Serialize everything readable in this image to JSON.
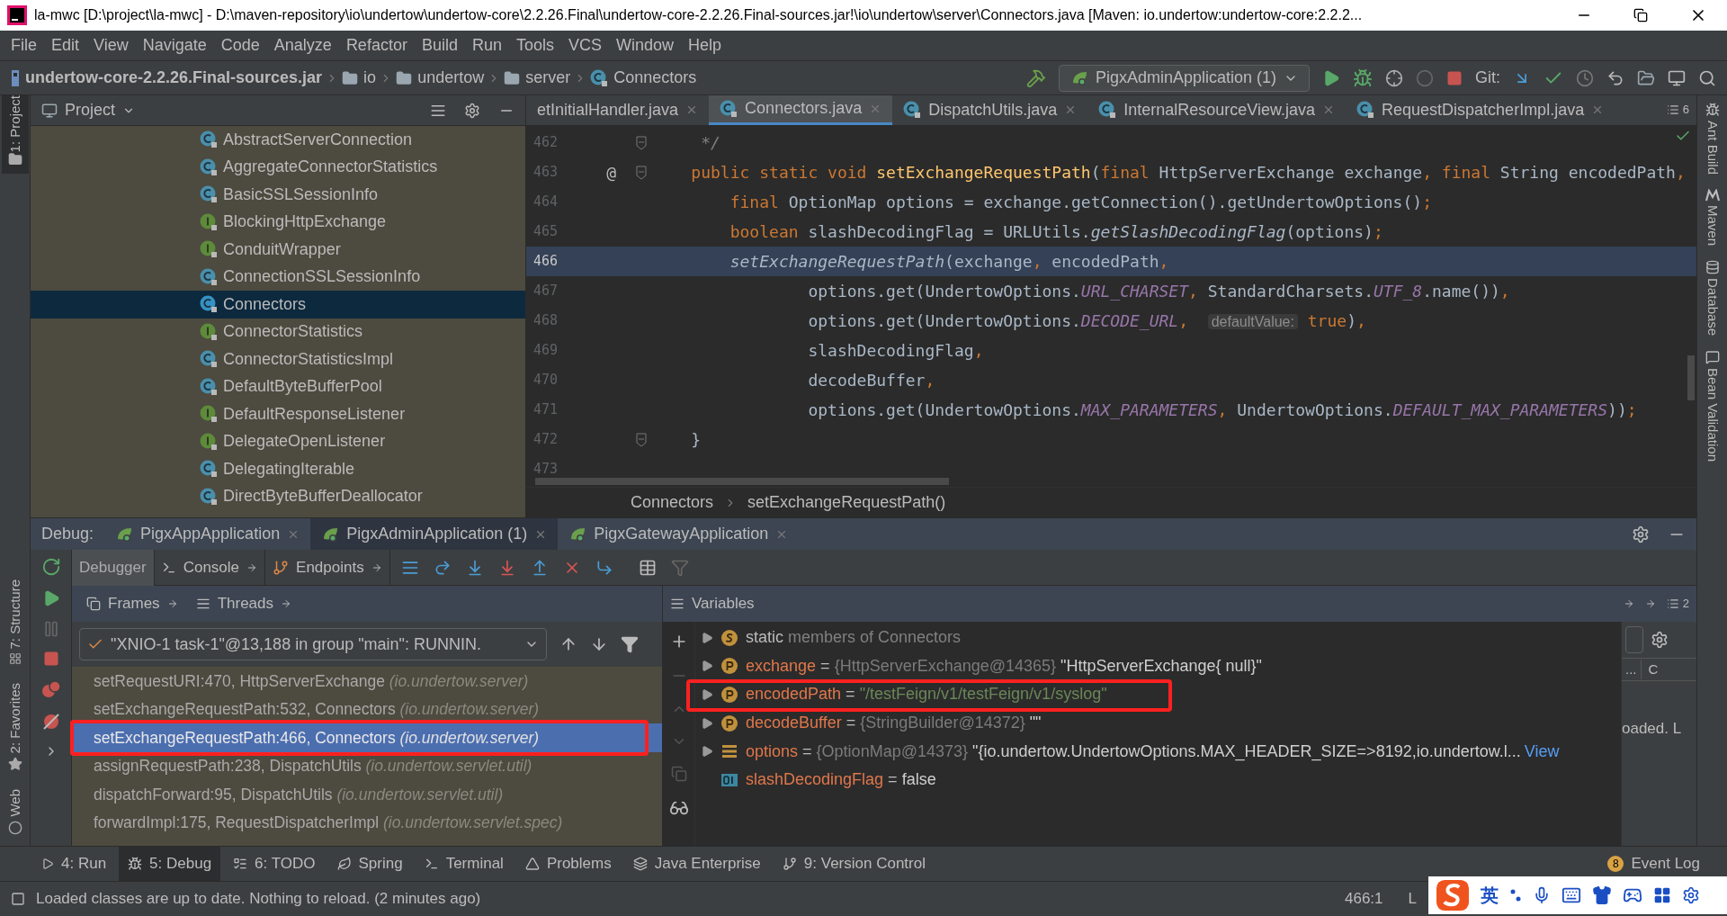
{
  "window": {
    "title": "la-mwc [D:\\project\\la-mwc] - D:\\maven-repository\\io\\undertow\\undertow-core\\2.2.26.Final\\undertow-core-2.2.26.Final-sources.jar!\\io\\undertow\\server\\Connectors.java [Maven: io.undertow:undertow-core:2.2.2..."
  },
  "menu": [
    "File",
    "Edit",
    "View",
    "Navigate",
    "Code",
    "Analyze",
    "Refactor",
    "Build",
    "Run",
    "Tools",
    "VCS",
    "Window",
    "Help"
  ],
  "nav": {
    "crumbs": [
      {
        "label": "undertow-core-2.2.26.Final-sources.jar",
        "kind": "jar"
      },
      {
        "label": "io",
        "kind": "folder"
      },
      {
        "label": "undertow",
        "kind": "folder"
      },
      {
        "label": "server",
        "kind": "folder"
      },
      {
        "label": "Connectors",
        "kind": "class"
      }
    ],
    "run_config": "PigxAdminApplication (1)",
    "git_label": "Git:"
  },
  "left_strip": [
    {
      "label": "1: Project",
      "selected": true
    },
    {
      "label": "7: Structure",
      "selected": false
    },
    {
      "label": "2: Favorites",
      "selected": false
    },
    {
      "label": "Web",
      "selected": false
    }
  ],
  "right_strip": [
    "Ant Build",
    "Maven",
    "Database",
    "Bean Validation"
  ],
  "project": {
    "title": "Project",
    "items": [
      {
        "label": "AbstractServerConnection",
        "kind": "class",
        "selected": false
      },
      {
        "label": "AggregateConnectorStatistics",
        "kind": "class",
        "selected": false
      },
      {
        "label": "BasicSSLSessionInfo",
        "kind": "class",
        "selected": false
      },
      {
        "label": "BlockingHttpExchange",
        "kind": "interface",
        "selected": false
      },
      {
        "label": "ConduitWrapper",
        "kind": "interface",
        "selected": false
      },
      {
        "label": "ConnectionSSLSessionInfo",
        "kind": "class",
        "selected": false
      },
      {
        "label": "Connectors",
        "kind": "class",
        "selected": true
      },
      {
        "label": "ConnectorStatistics",
        "kind": "interface",
        "selected": false
      },
      {
        "label": "ConnectorStatisticsImpl",
        "kind": "class",
        "selected": false
      },
      {
        "label": "DefaultByteBufferPool",
        "kind": "class",
        "selected": false
      },
      {
        "label": "DefaultResponseListener",
        "kind": "interface",
        "selected": false
      },
      {
        "label": "DelegateOpenListener",
        "kind": "interface",
        "selected": false
      },
      {
        "label": "DelegatingIterable",
        "kind": "class",
        "selected": false
      },
      {
        "label": "DirectByteBufferDeallocator",
        "kind": "class",
        "selected": false
      }
    ]
  },
  "editor": {
    "tabs": [
      {
        "label": "etInitialHandler.java",
        "selected": false
      },
      {
        "label": "Connectors.java",
        "selected": true
      },
      {
        "label": "DispatchUtils.java",
        "selected": false
      },
      {
        "label": "InternalResourceView.java",
        "selected": false
      },
      {
        "label": "RequestDispatcherImpl.java",
        "selected": false
      }
    ],
    "tab_count": "6",
    "lines": [
      {
        "number": "462",
        "current": false,
        "tokens": [
          {
            "kind": "comment",
            "text": "     */"
          }
        ]
      },
      {
        "number": "463",
        "current": false,
        "override": "@",
        "tokens": [
          {
            "kind": "keyword",
            "text": "    public static void "
          },
          {
            "kind": "method",
            "text": "setExchangeRequestPath"
          },
          {
            "kind": "plain",
            "text": "("
          },
          {
            "kind": "keyword",
            "text": "final "
          },
          {
            "kind": "plain",
            "text": "HttpServerExchange exchange"
          },
          {
            "kind": "keyword",
            "text": ", final "
          },
          {
            "kind": "plain",
            "text": "String encodedPath"
          },
          {
            "kind": "keyword",
            "text": ","
          }
        ]
      },
      {
        "number": "464",
        "current": false,
        "tokens": [
          {
            "kind": "keyword",
            "text": "        final "
          },
          {
            "kind": "plain",
            "text": "OptionMap options = exchange.getConnection().getUndertowOptions()"
          },
          {
            "kind": "keyword",
            "text": ";"
          }
        ]
      },
      {
        "number": "465",
        "current": false,
        "tokens": [
          {
            "kind": "keyword",
            "text": "        boolean "
          },
          {
            "kind": "plain",
            "text": "slashDecodingFlag = URLUtils."
          },
          {
            "kind": "static_call",
            "text": "getSlashDecodingFlag"
          },
          {
            "kind": "plain",
            "text": "(options)"
          },
          {
            "kind": "keyword",
            "text": ";"
          }
        ]
      },
      {
        "number": "466",
        "current": true,
        "tokens": [
          {
            "kind": "static_call",
            "text": "        setExchangeRequestPath"
          },
          {
            "kind": "plain",
            "text": "(exchange"
          },
          {
            "kind": "keyword",
            "text": ", "
          },
          {
            "kind": "plain",
            "text": "encodedPath"
          },
          {
            "kind": "keyword",
            "text": ","
          }
        ]
      },
      {
        "number": "467",
        "current": false,
        "tokens": [
          {
            "kind": "plain",
            "text": "                options.get(UndertowOptions."
          },
          {
            "kind": "field",
            "text": "URL_CHARSET"
          },
          {
            "kind": "keyword",
            "text": ", "
          },
          {
            "kind": "plain",
            "text": "StandardCharsets."
          },
          {
            "kind": "field",
            "text": "UTF_8"
          },
          {
            "kind": "plain",
            "text": ".name())"
          },
          {
            "kind": "keyword",
            "text": ","
          }
        ]
      },
      {
        "number": "468",
        "current": false,
        "tokens": [
          {
            "kind": "plain",
            "text": "                options.get(UndertowOptions."
          },
          {
            "kind": "field",
            "text": "DECODE_URL"
          },
          {
            "kind": "keyword",
            "text": ",  "
          },
          {
            "kind": "hint",
            "text": "defaultValue:"
          },
          {
            "kind": "keyword",
            "text": " true"
          },
          {
            "kind": "plain",
            "text": ")"
          },
          {
            "kind": "keyword",
            "text": ","
          }
        ]
      },
      {
        "number": "469",
        "current": false,
        "tokens": [
          {
            "kind": "plain",
            "text": "                slashDecodingFlag"
          },
          {
            "kind": "keyword",
            "text": ","
          }
        ]
      },
      {
        "number": "470",
        "current": false,
        "tokens": [
          {
            "kind": "plain",
            "text": "                decodeBuffer"
          },
          {
            "kind": "keyword",
            "text": ","
          }
        ]
      },
      {
        "number": "471",
        "current": false,
        "tokens": [
          {
            "kind": "plain",
            "text": "                options.get(UndertowOptions."
          },
          {
            "kind": "field",
            "text": "MAX_PARAMETERS"
          },
          {
            "kind": "keyword",
            "text": ", "
          },
          {
            "kind": "plain",
            "text": "UndertowOptions."
          },
          {
            "kind": "field",
            "text": "DEFAULT_MAX_PARAMETERS"
          },
          {
            "kind": "plain",
            "text": "))"
          },
          {
            "kind": "keyword",
            "text": ";"
          }
        ]
      },
      {
        "number": "472",
        "current": false,
        "tokens": [
          {
            "kind": "plain",
            "text": "    }"
          }
        ]
      },
      {
        "number": "473",
        "current": false
      }
    ],
    "breadcrumb": [
      "Connectors",
      "setExchangeRequestPath()"
    ]
  },
  "debug": {
    "label": "Debug:",
    "tabs": [
      {
        "label": "PigxAppApplication",
        "selected": false
      },
      {
        "label": "PigxAdminApplication (1)",
        "selected": true
      },
      {
        "label": "PigxGatewayApplication",
        "selected": false
      }
    ],
    "subtabs": [
      {
        "label": "Debugger",
        "selected": true
      },
      {
        "label": "Console",
        "selected": false
      },
      {
        "label": "Endpoints",
        "selected": false
      }
    ],
    "frames_tabs": [
      "Frames",
      "Threads"
    ],
    "thread": "\"XNIO-1 task-1\"@13,188 in group \"main\": RUNNIN.",
    "frames": [
      {
        "method": "setRequestURI:470, HttpServerExchange",
        "package": "(io.undertow.server)",
        "selected": false
      },
      {
        "method": "setExchangeRequestPath:532, Connectors",
        "package": "(io.undertow.server)",
        "selected": false
      },
      {
        "method": "setExchangeRequestPath:466, Connectors",
        "package": "(io.undertow.server)",
        "selected": true
      },
      {
        "method": "assignRequestPath:238, DispatchUtils",
        "package": "(io.undertow.servlet.util)",
        "selected": false
      },
      {
        "method": "dispatchForward:95, DispatchUtils",
        "package": "(io.undertow.servlet.util)",
        "selected": false
      },
      {
        "method": "forwardImpl:175, RequestDispatcherImpl",
        "package": "(io.undertow.servlet.spec)",
        "selected": false
      }
    ],
    "variables_title": "Variables",
    "layout_count": "2",
    "variables": [
      {
        "kind": "static",
        "name": "static",
        "value": "members of Connectors",
        "expandable": true
      },
      {
        "kind": "parameter",
        "name": "exchange",
        "operator": "=",
        "ref": "{HttpServerExchange@14365}",
        "value": "\"HttpServerExchange{  null}\"",
        "expandable": true
      },
      {
        "kind": "parameter",
        "name": "encodedPath",
        "operator": "=",
        "value": "\"/testFeign/v1/testFeign/v1/syslog\"",
        "expandable": true
      },
      {
        "kind": "parameter",
        "name": "decodeBuffer",
        "operator": "=",
        "ref": "{StringBuilder@14372}",
        "value": "\"\"",
        "expandable": true
      },
      {
        "kind": "map",
        "name": "options",
        "operator": "=",
        "ref": "{OptionMap@14373}",
        "value": "\"{io.undertow.UndertowOptions.MAX_HEADER_SIZE=>8192,io.undertow.l...",
        "link": "View",
        "expandable": true
      },
      {
        "kind": "primitive",
        "name": "slashDecodingFlag",
        "operator": "=",
        "value": "false",
        "expandable": false
      }
    ],
    "side": {
      "button": "...",
      "column": "C",
      "text": "oaded. L"
    }
  },
  "tool_windows": [
    {
      "label": "4: Run",
      "kind": "run",
      "selected": false
    },
    {
      "label": "5: Debug",
      "kind": "debug",
      "selected": true
    },
    {
      "label": "6: TODO",
      "kind": "todo",
      "selected": false
    },
    {
      "label": "Spring",
      "kind": "spring",
      "selected": false
    },
    {
      "label": "Terminal",
      "kind": "terminal",
      "selected": false
    },
    {
      "label": "Problems",
      "kind": "problems",
      "selected": false
    },
    {
      "label": "Java Enterprise",
      "kind": "enterprise",
      "selected": false
    },
    {
      "label": "9: Version Control",
      "kind": "vcs",
      "selected": false
    }
  ],
  "event_log": {
    "label": "Event Log",
    "count": "8"
  },
  "status": {
    "message": "Loaded classes are up to date. Nothing to reload. (2 minutes ago)",
    "position": "466:1",
    "extra": "L"
  },
  "ime": {
    "label": "英"
  }
}
